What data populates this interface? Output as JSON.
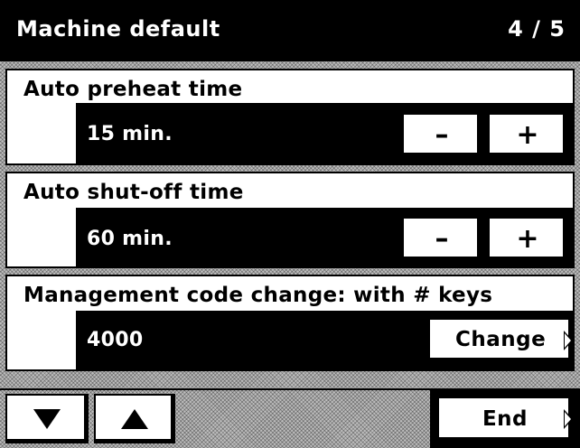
{
  "header": {
    "title": "Machine default",
    "page_indicator": "4 / 5"
  },
  "settings": [
    {
      "label": "Auto preheat time",
      "value": "15 min.",
      "minus_label": "–",
      "plus_label": "+"
    },
    {
      "label": "Auto shut-off time",
      "value": "60 min.",
      "minus_label": "–",
      "plus_label": "+"
    },
    {
      "label": "Management code change: with  # keys",
      "value": "4000",
      "change_label": "Change"
    }
  ],
  "footer": {
    "end_label": "End",
    "down_icon": "triangle-down",
    "up_icon": "triangle-up"
  }
}
